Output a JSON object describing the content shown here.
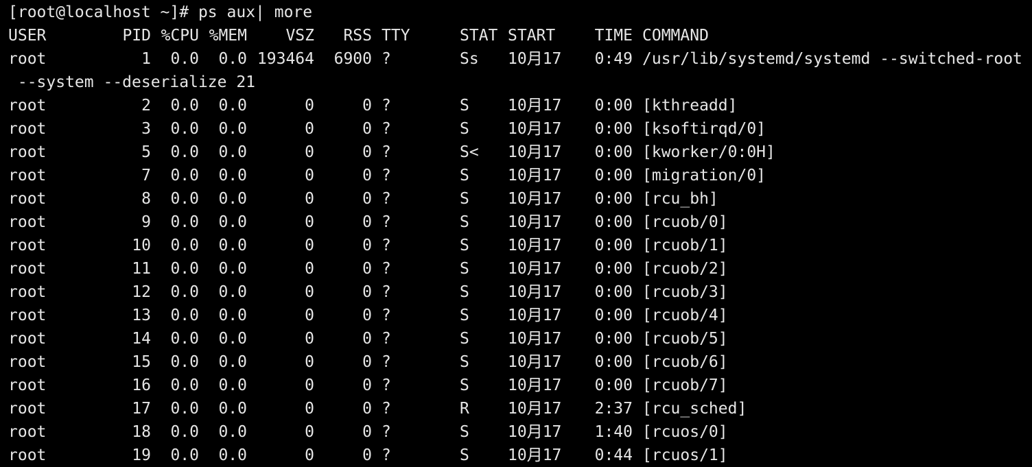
{
  "terminal": {
    "prompt": "[root@localhost ~]# ",
    "command": "ps aux| more",
    "headers": [
      "USER",
      "PID",
      "%CPU",
      "%MEM",
      "VSZ",
      "RSS",
      "TTY",
      "STAT",
      "START",
      "TIME",
      "COMMAND"
    ],
    "rows": [
      {
        "user": "root",
        "pid": "1",
        "cpu": "0.0",
        "mem": "0.0",
        "vsz": "193464",
        "rss": "6900",
        "tty": "?",
        "stat": "Ss",
        "start": "10月17",
        "time": "0:49",
        "command": "/usr/lib/systemd/systemd --switched-root",
        "wrap": " --system --deserialize 21"
      },
      {
        "user": "root",
        "pid": "2",
        "cpu": "0.0",
        "mem": "0.0",
        "vsz": "0",
        "rss": "0",
        "tty": "?",
        "stat": "S",
        "start": "10月17",
        "time": "0:00",
        "command": "[kthreadd]"
      },
      {
        "user": "root",
        "pid": "3",
        "cpu": "0.0",
        "mem": "0.0",
        "vsz": "0",
        "rss": "0",
        "tty": "?",
        "stat": "S",
        "start": "10月17",
        "time": "0:00",
        "command": "[ksoftirqd/0]"
      },
      {
        "user": "root",
        "pid": "5",
        "cpu": "0.0",
        "mem": "0.0",
        "vsz": "0",
        "rss": "0",
        "tty": "?",
        "stat": "S<",
        "start": "10月17",
        "time": "0:00",
        "command": "[kworker/0:0H]"
      },
      {
        "user": "root",
        "pid": "7",
        "cpu": "0.0",
        "mem": "0.0",
        "vsz": "0",
        "rss": "0",
        "tty": "?",
        "stat": "S",
        "start": "10月17",
        "time": "0:00",
        "command": "[migration/0]"
      },
      {
        "user": "root",
        "pid": "8",
        "cpu": "0.0",
        "mem": "0.0",
        "vsz": "0",
        "rss": "0",
        "tty": "?",
        "stat": "S",
        "start": "10月17",
        "time": "0:00",
        "command": "[rcu_bh]"
      },
      {
        "user": "root",
        "pid": "9",
        "cpu": "0.0",
        "mem": "0.0",
        "vsz": "0",
        "rss": "0",
        "tty": "?",
        "stat": "S",
        "start": "10月17",
        "time": "0:00",
        "command": "[rcuob/0]"
      },
      {
        "user": "root",
        "pid": "10",
        "cpu": "0.0",
        "mem": "0.0",
        "vsz": "0",
        "rss": "0",
        "tty": "?",
        "stat": "S",
        "start": "10月17",
        "time": "0:00",
        "command": "[rcuob/1]"
      },
      {
        "user": "root",
        "pid": "11",
        "cpu": "0.0",
        "mem": "0.0",
        "vsz": "0",
        "rss": "0",
        "tty": "?",
        "stat": "S",
        "start": "10月17",
        "time": "0:00",
        "command": "[rcuob/2]"
      },
      {
        "user": "root",
        "pid": "12",
        "cpu": "0.0",
        "mem": "0.0",
        "vsz": "0",
        "rss": "0",
        "tty": "?",
        "stat": "S",
        "start": "10月17",
        "time": "0:00",
        "command": "[rcuob/3]"
      },
      {
        "user": "root",
        "pid": "13",
        "cpu": "0.0",
        "mem": "0.0",
        "vsz": "0",
        "rss": "0",
        "tty": "?",
        "stat": "S",
        "start": "10月17",
        "time": "0:00",
        "command": "[rcuob/4]"
      },
      {
        "user": "root",
        "pid": "14",
        "cpu": "0.0",
        "mem": "0.0",
        "vsz": "0",
        "rss": "0",
        "tty": "?",
        "stat": "S",
        "start": "10月17",
        "time": "0:00",
        "command": "[rcuob/5]"
      },
      {
        "user": "root",
        "pid": "15",
        "cpu": "0.0",
        "mem": "0.0",
        "vsz": "0",
        "rss": "0",
        "tty": "?",
        "stat": "S",
        "start": "10月17",
        "time": "0:00",
        "command": "[rcuob/6]"
      },
      {
        "user": "root",
        "pid": "16",
        "cpu": "0.0",
        "mem": "0.0",
        "vsz": "0",
        "rss": "0",
        "tty": "?",
        "stat": "S",
        "start": "10月17",
        "time": "0:00",
        "command": "[rcuob/7]"
      },
      {
        "user": "root",
        "pid": "17",
        "cpu": "0.0",
        "mem": "0.0",
        "vsz": "0",
        "rss": "0",
        "tty": "?",
        "stat": "R",
        "start": "10月17",
        "time": "2:37",
        "command": "[rcu_sched]"
      },
      {
        "user": "root",
        "pid": "18",
        "cpu": "0.0",
        "mem": "0.0",
        "vsz": "0",
        "rss": "0",
        "tty": "?",
        "stat": "S",
        "start": "10月17",
        "time": "1:40",
        "command": "[rcuos/0]"
      },
      {
        "user": "root",
        "pid": "19",
        "cpu": "0.0",
        "mem": "0.0",
        "vsz": "0",
        "rss": "0",
        "tty": "?",
        "stat": "S",
        "start": "10月17",
        "time": "0:44",
        "command": "[rcuos/1]"
      }
    ]
  },
  "colors": {
    "background": "#000000",
    "foreground": "#e6e6e6"
  }
}
